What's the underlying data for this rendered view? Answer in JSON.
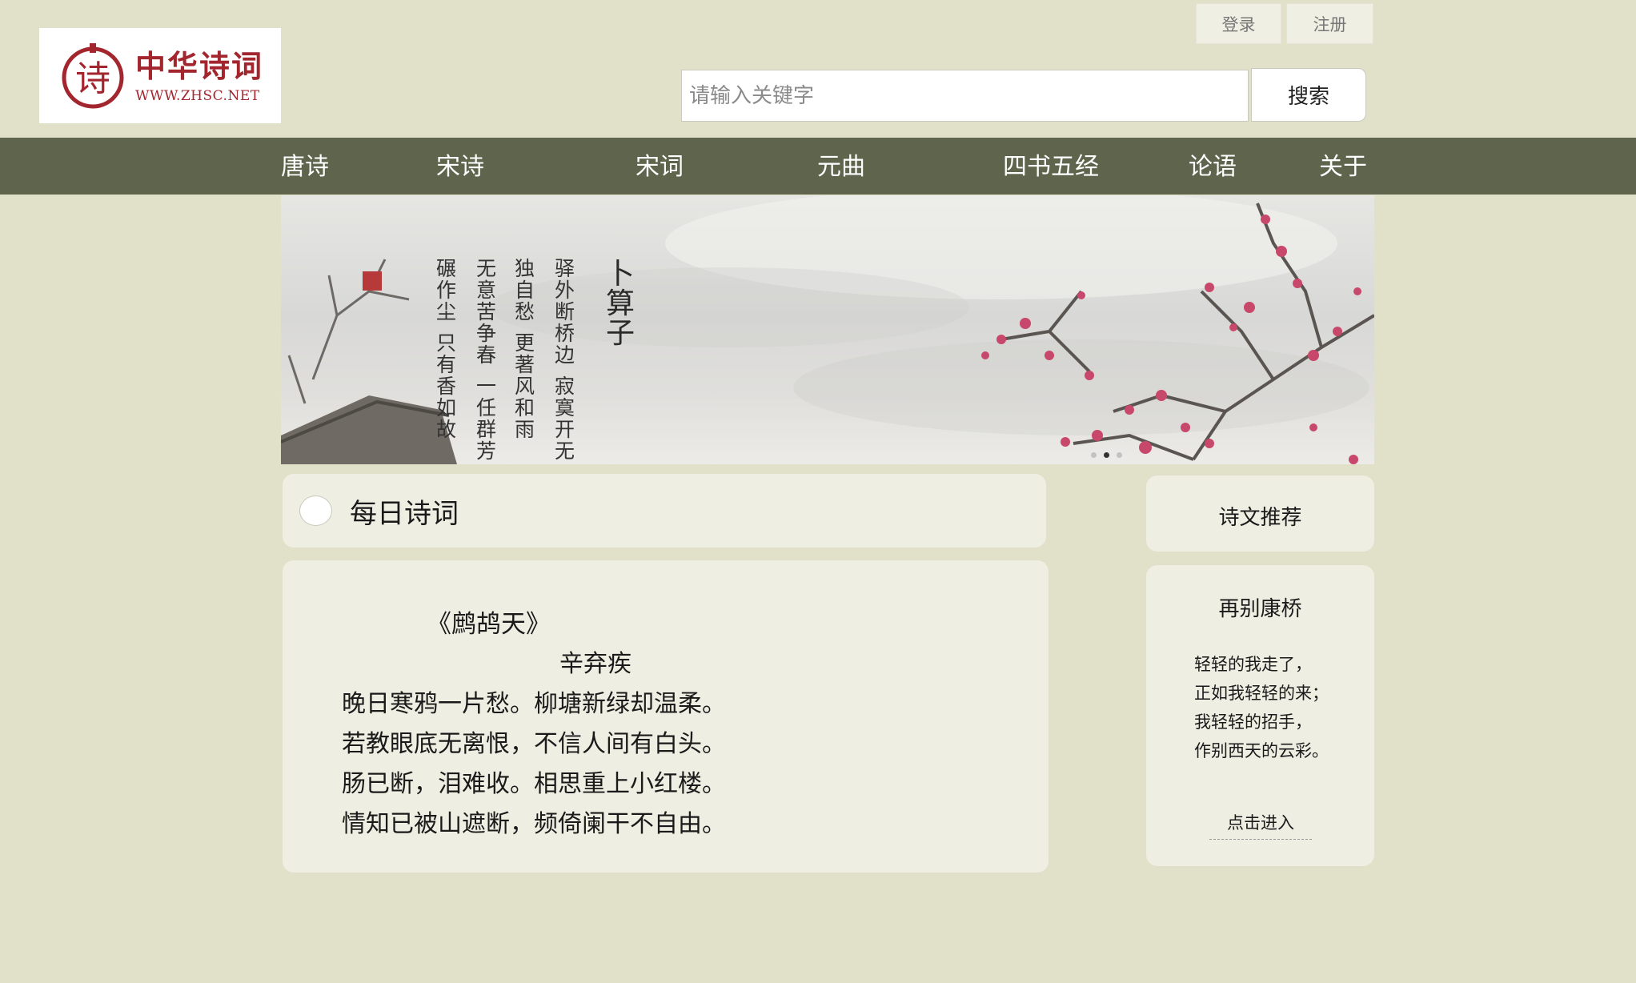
{
  "logo": {
    "name": "中华诗词",
    "url": "WWW.ZHSC.NET",
    "mark_char": "诗",
    "brand_color": "#a3262f"
  },
  "auth": {
    "login": "登录",
    "register": "注册"
  },
  "search": {
    "placeholder": "请输入关键字",
    "button": "搜索"
  },
  "nav": {
    "items": [
      "唐诗",
      "宋诗",
      "宋词",
      "元曲",
      "四书五经",
      "论语",
      "关于"
    ],
    "bg_color": "#5f654c"
  },
  "banner": {
    "title": "卜算子",
    "columns": [
      "驿外断桥边",
      "寂寞开无主",
      "独自愁",
      "更著风和雨",
      "无意苦争春",
      "一任群芳",
      "碾作尘",
      "只有香如故"
    ],
    "dots": 3,
    "active_dot": 2
  },
  "daily": {
    "title": "每日诗词"
  },
  "poem": {
    "title": "《鹧鸪天》",
    "author": "辛弃疾",
    "lines": [
      "晚日寒鸦一片愁。柳塘新绿却温柔。",
      "若教眼底无离恨，不信人间有白头。",
      "肠已断，泪难收。相思重上小红楼。",
      "情知已被山遮断，频倚阑干不自由。"
    ]
  },
  "sidebar": {
    "header": "诗文推荐",
    "card": {
      "title": "再别康桥",
      "lines": [
        "轻轻的我走了，",
        "正如我轻轻的来；",
        "我轻轻的招手，",
        "作别西天的云彩。"
      ],
      "link": "点击进入"
    }
  },
  "colors": {
    "page_bg": "#e1e0c8",
    "card_bg": "#efeee2"
  }
}
